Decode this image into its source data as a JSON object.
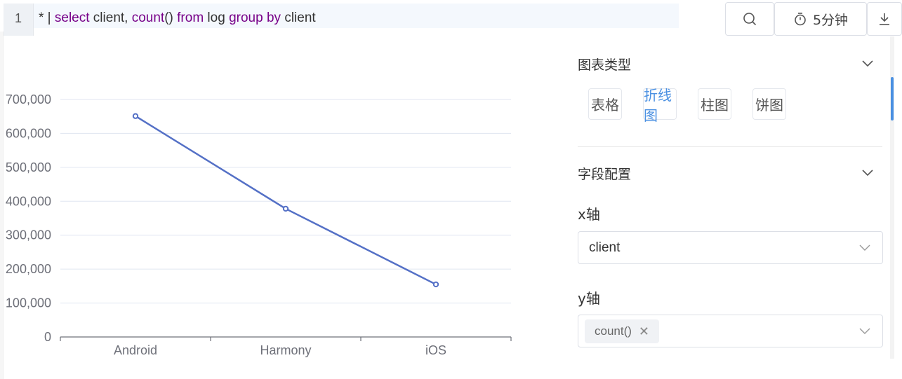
{
  "editor": {
    "line_number": "1",
    "query_parts": [
      {
        "text": "* | ",
        "kind": "plain"
      },
      {
        "text": "select",
        "kind": "kw"
      },
      {
        "text": " client, ",
        "kind": "plain"
      },
      {
        "text": "count",
        "kind": "kw"
      },
      {
        "text": "() ",
        "kind": "plain"
      },
      {
        "text": "from",
        "kind": "kw"
      },
      {
        "text": " log ",
        "kind": "plain"
      },
      {
        "text": "group",
        "kind": "kw"
      },
      {
        "text": " ",
        "kind": "plain"
      },
      {
        "text": "by",
        "kind": "kw"
      },
      {
        "text": " client",
        "kind": "plain"
      }
    ]
  },
  "toolbar": {
    "search_icon": "search-icon",
    "time_icon": "stopwatch-icon",
    "time_label": "5分钟",
    "download_icon": "download-icon"
  },
  "chart_data": {
    "type": "line",
    "categories": [
      "Android",
      "Harmony",
      "iOS"
    ],
    "values": [
      651000,
      378000,
      155000
    ],
    "ylim": [
      0,
      700000
    ],
    "yticks": [
      0,
      100000,
      200000,
      300000,
      400000,
      500000,
      600000,
      700000
    ],
    "ytick_labels": [
      "0",
      "100,000",
      "200,000",
      "300,000",
      "400,000",
      "500,000",
      "600,000",
      "700,000"
    ],
    "grid": true,
    "line_color": "#5470c6"
  },
  "panel": {
    "chart_type_title": "图表类型",
    "chart_types": [
      {
        "label": "表格",
        "active": false
      },
      {
        "label": "折线图",
        "active": true
      },
      {
        "label": "柱图",
        "active": false
      },
      {
        "label": "饼图",
        "active": false
      }
    ],
    "field_config_title": "字段配置",
    "x_axis_label": "x轴",
    "x_axis_value": "client",
    "y_axis_label": "y轴",
    "y_axis_tag": "count()",
    "accent_color": "#4a90e2"
  }
}
